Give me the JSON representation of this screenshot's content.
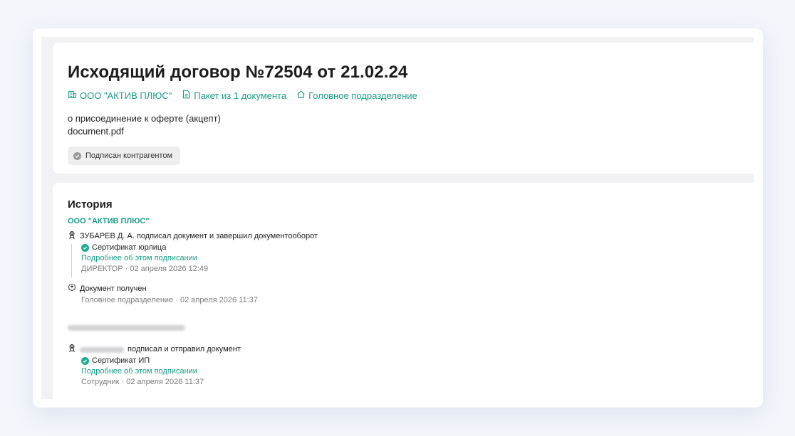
{
  "document": {
    "title": "Исходящий договор №72504 от 21.02.24",
    "meta": [
      {
        "icon": "building-icon",
        "label": "ООО \"АКТИВ ПЛЮС\""
      },
      {
        "icon": "document-icon",
        "label": "Пакет из 1 документа"
      },
      {
        "icon": "home-icon",
        "label": "Головное подразделение"
      }
    ],
    "description": "о присоединение к оферте (акцепт)",
    "filename": "document.pdf",
    "status": "Подписан контрагентом"
  },
  "history": {
    "title": "История",
    "org1": "ООО \"АКТИВ ПЛЮС\"",
    "events": [
      {
        "icon": "award-icon",
        "text": "ЗУБАРЕВ Д. А. подписал документ и завершил документооборот",
        "certificate": "Сертификат юрлица",
        "details_link": "Подробнее об этом подписании",
        "meta": "ДИРЕКТОР · 02 апреля 2026 12:49"
      },
      {
        "icon": "receive-icon",
        "text": "Документ получен",
        "meta": "Головное подразделение · 02 апреля 2026 11:37"
      },
      {
        "icon": "award-icon",
        "text": "подписал и отправил документ",
        "certificate": "Сертификат ИП",
        "details_link": "Подробнее об этом подписании",
        "meta": "Сотрудник · 02 апреля 2026 11:37"
      }
    ]
  },
  "colors": {
    "accent": "#1a9e86",
    "background": "#f2f2f4",
    "success": "#1fae8f"
  }
}
